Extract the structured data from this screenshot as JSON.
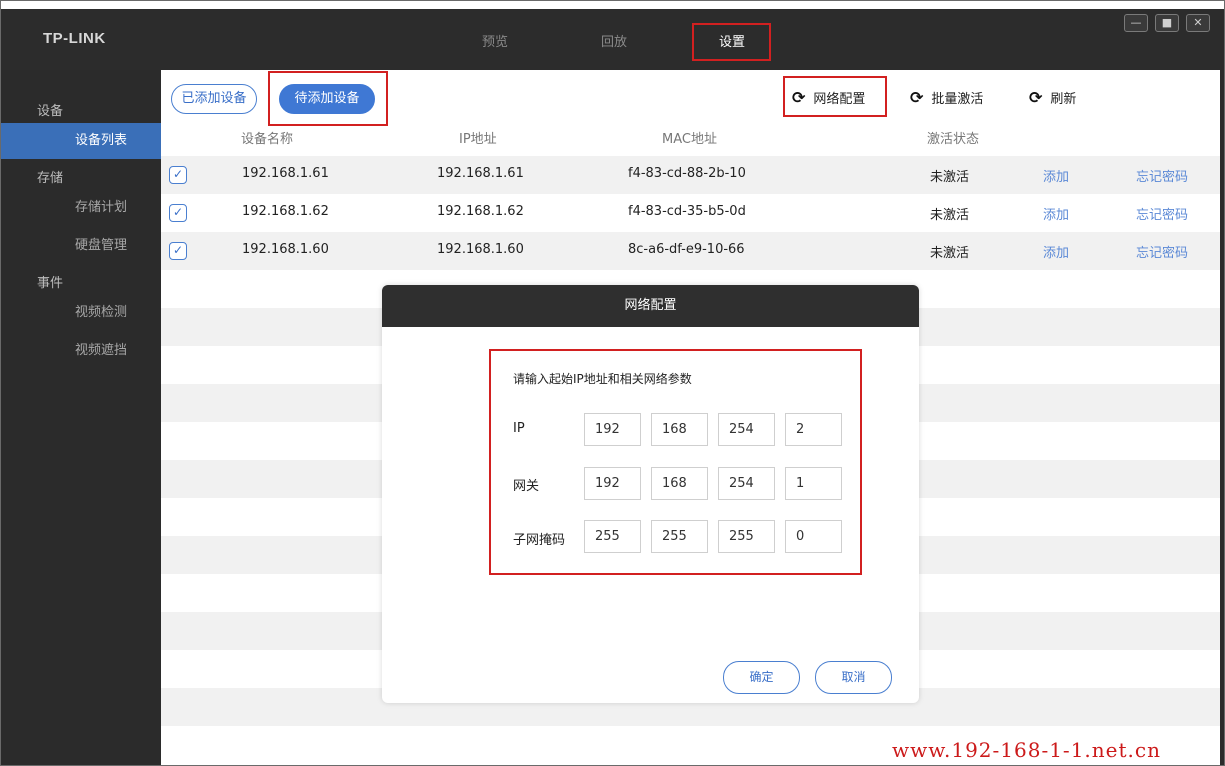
{
  "app": {
    "logo": "TP-LINK",
    "nav_tabs": [
      {
        "label": "预览"
      },
      {
        "label": "回放"
      },
      {
        "label": "设置"
      }
    ],
    "window_controls": [
      "minimize-icon",
      "maximize-icon",
      "close-icon"
    ]
  },
  "sidebar": {
    "groups": [
      "设备",
      "存储",
      "事件"
    ],
    "items": [
      {
        "label": "设备列表"
      },
      {
        "label": "存储计划"
      },
      {
        "label": "硬盘管理"
      },
      {
        "label": "视频检测"
      },
      {
        "label": "视频遮挡"
      }
    ]
  },
  "toolbar": {
    "added_label": "已添加设备",
    "pending_label": "待添加设备",
    "network_config_label": "网络配置",
    "batch_activate_label": "批量激活",
    "refresh_label": "刷新",
    "refresh_icon": "refresh-icon"
  },
  "table": {
    "headers": {
      "name": "设备名称",
      "ip": "IP地址",
      "mac": "MAC地址",
      "status": "激活状态"
    },
    "rows": [
      {
        "name": "192.168.1.61",
        "ip": "192.168.1.61",
        "mac": "f4-83-cd-88-2b-10",
        "status": "未激活",
        "add": "添加",
        "forgot": "忘记密码"
      },
      {
        "name": "192.168.1.62",
        "ip": "192.168.1.62",
        "mac": "f4-83-cd-35-b5-0d",
        "status": "未激活",
        "add": "添加",
        "forgot": "忘记密码"
      },
      {
        "name": "192.168.1.60",
        "ip": "192.168.1.60",
        "mac": "8c-a6-df-e9-10-66",
        "status": "未激活",
        "add": "添加",
        "forgot": "忘记密码"
      }
    ]
  },
  "dialog": {
    "title": "网络配置",
    "prompt": "请输入起始IP地址和相关网络参数",
    "fields": [
      {
        "label": "IP",
        "octets": [
          "192",
          "168",
          "254",
          "2"
        ]
      },
      {
        "label": "网关",
        "octets": [
          "192",
          "168",
          "254",
          "1"
        ]
      },
      {
        "label": "子网掩码",
        "octets": [
          "255",
          "255",
          "255",
          "0"
        ]
      }
    ],
    "confirm_label": "确定",
    "cancel_label": "取消"
  },
  "watermark": "www.192-168-1-1.net.cn",
  "colors": {
    "accent": "#3f78d4",
    "highlight_box": "#d22020",
    "titlebar": "#2c2c2c",
    "sidebar": "#2b2b2b"
  }
}
